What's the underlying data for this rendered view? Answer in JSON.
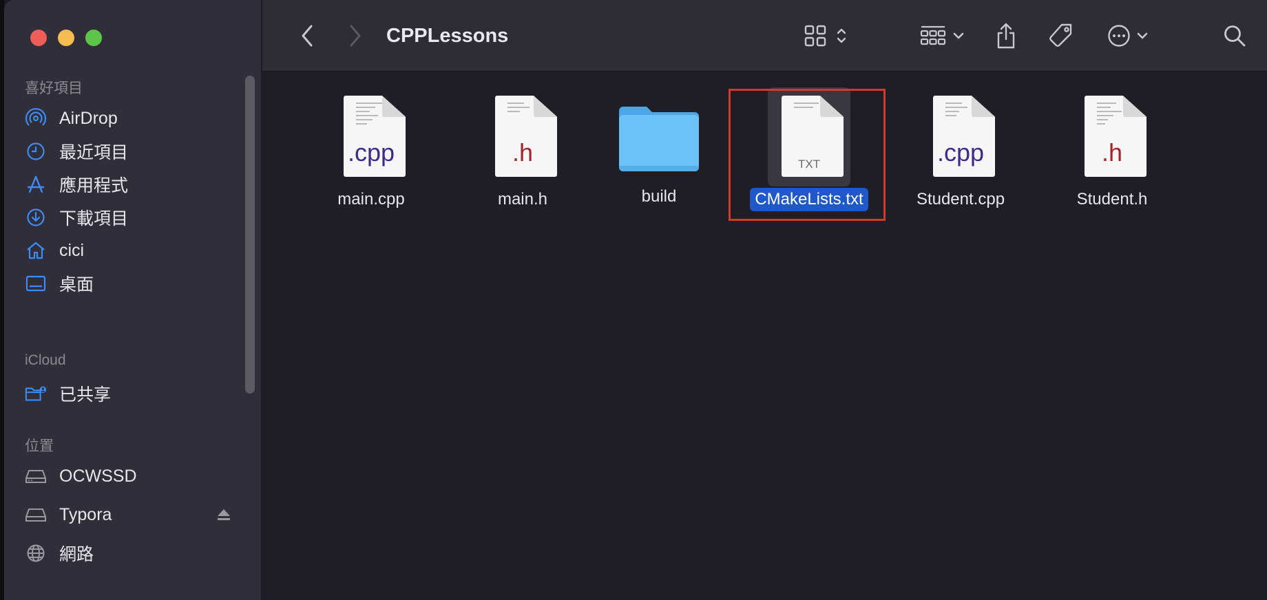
{
  "window": {
    "title": "CPPLessons"
  },
  "colors": {
    "accent": "#1f58c8",
    "sidebar_icon": "#3d8cf5",
    "annotation": "#d33a2c"
  },
  "sidebar": {
    "sections": [
      {
        "label": "喜好項目"
      },
      {
        "label": "iCloud"
      },
      {
        "label": "位置"
      }
    ],
    "favorites": [
      {
        "label": "AirDrop",
        "icon": "airdrop-icon"
      },
      {
        "label": "最近項目",
        "icon": "clock-icon"
      },
      {
        "label": "應用程式",
        "icon": "applications-icon"
      },
      {
        "label": "下載項目",
        "icon": "download-icon"
      },
      {
        "label": "cici",
        "icon": "home-icon"
      },
      {
        "label": "桌面",
        "icon": "desktop-icon"
      }
    ],
    "icloud": [
      {
        "label": "已共享",
        "icon": "shared-folder-icon"
      }
    ],
    "locations": [
      {
        "label": "OCWSSD",
        "icon": "drive-icon"
      },
      {
        "label": "Typora",
        "icon": "drive-icon"
      },
      {
        "label": "網路",
        "icon": "globe-icon"
      }
    ]
  },
  "files": [
    {
      "name": "main.cpp",
      "kind": "cpp",
      "ext": ".cpp"
    },
    {
      "name": "main.h",
      "kind": "h",
      "ext": ".h"
    },
    {
      "name": "build",
      "kind": "folder",
      "ext": ""
    },
    {
      "name": "CMakeLists.txt",
      "kind": "txt",
      "ext": "TXT",
      "selected": true
    },
    {
      "name": "Student.cpp",
      "kind": "cpp",
      "ext": ".cpp"
    },
    {
      "name": "Student.h",
      "kind": "h",
      "ext": ".h"
    }
  ]
}
